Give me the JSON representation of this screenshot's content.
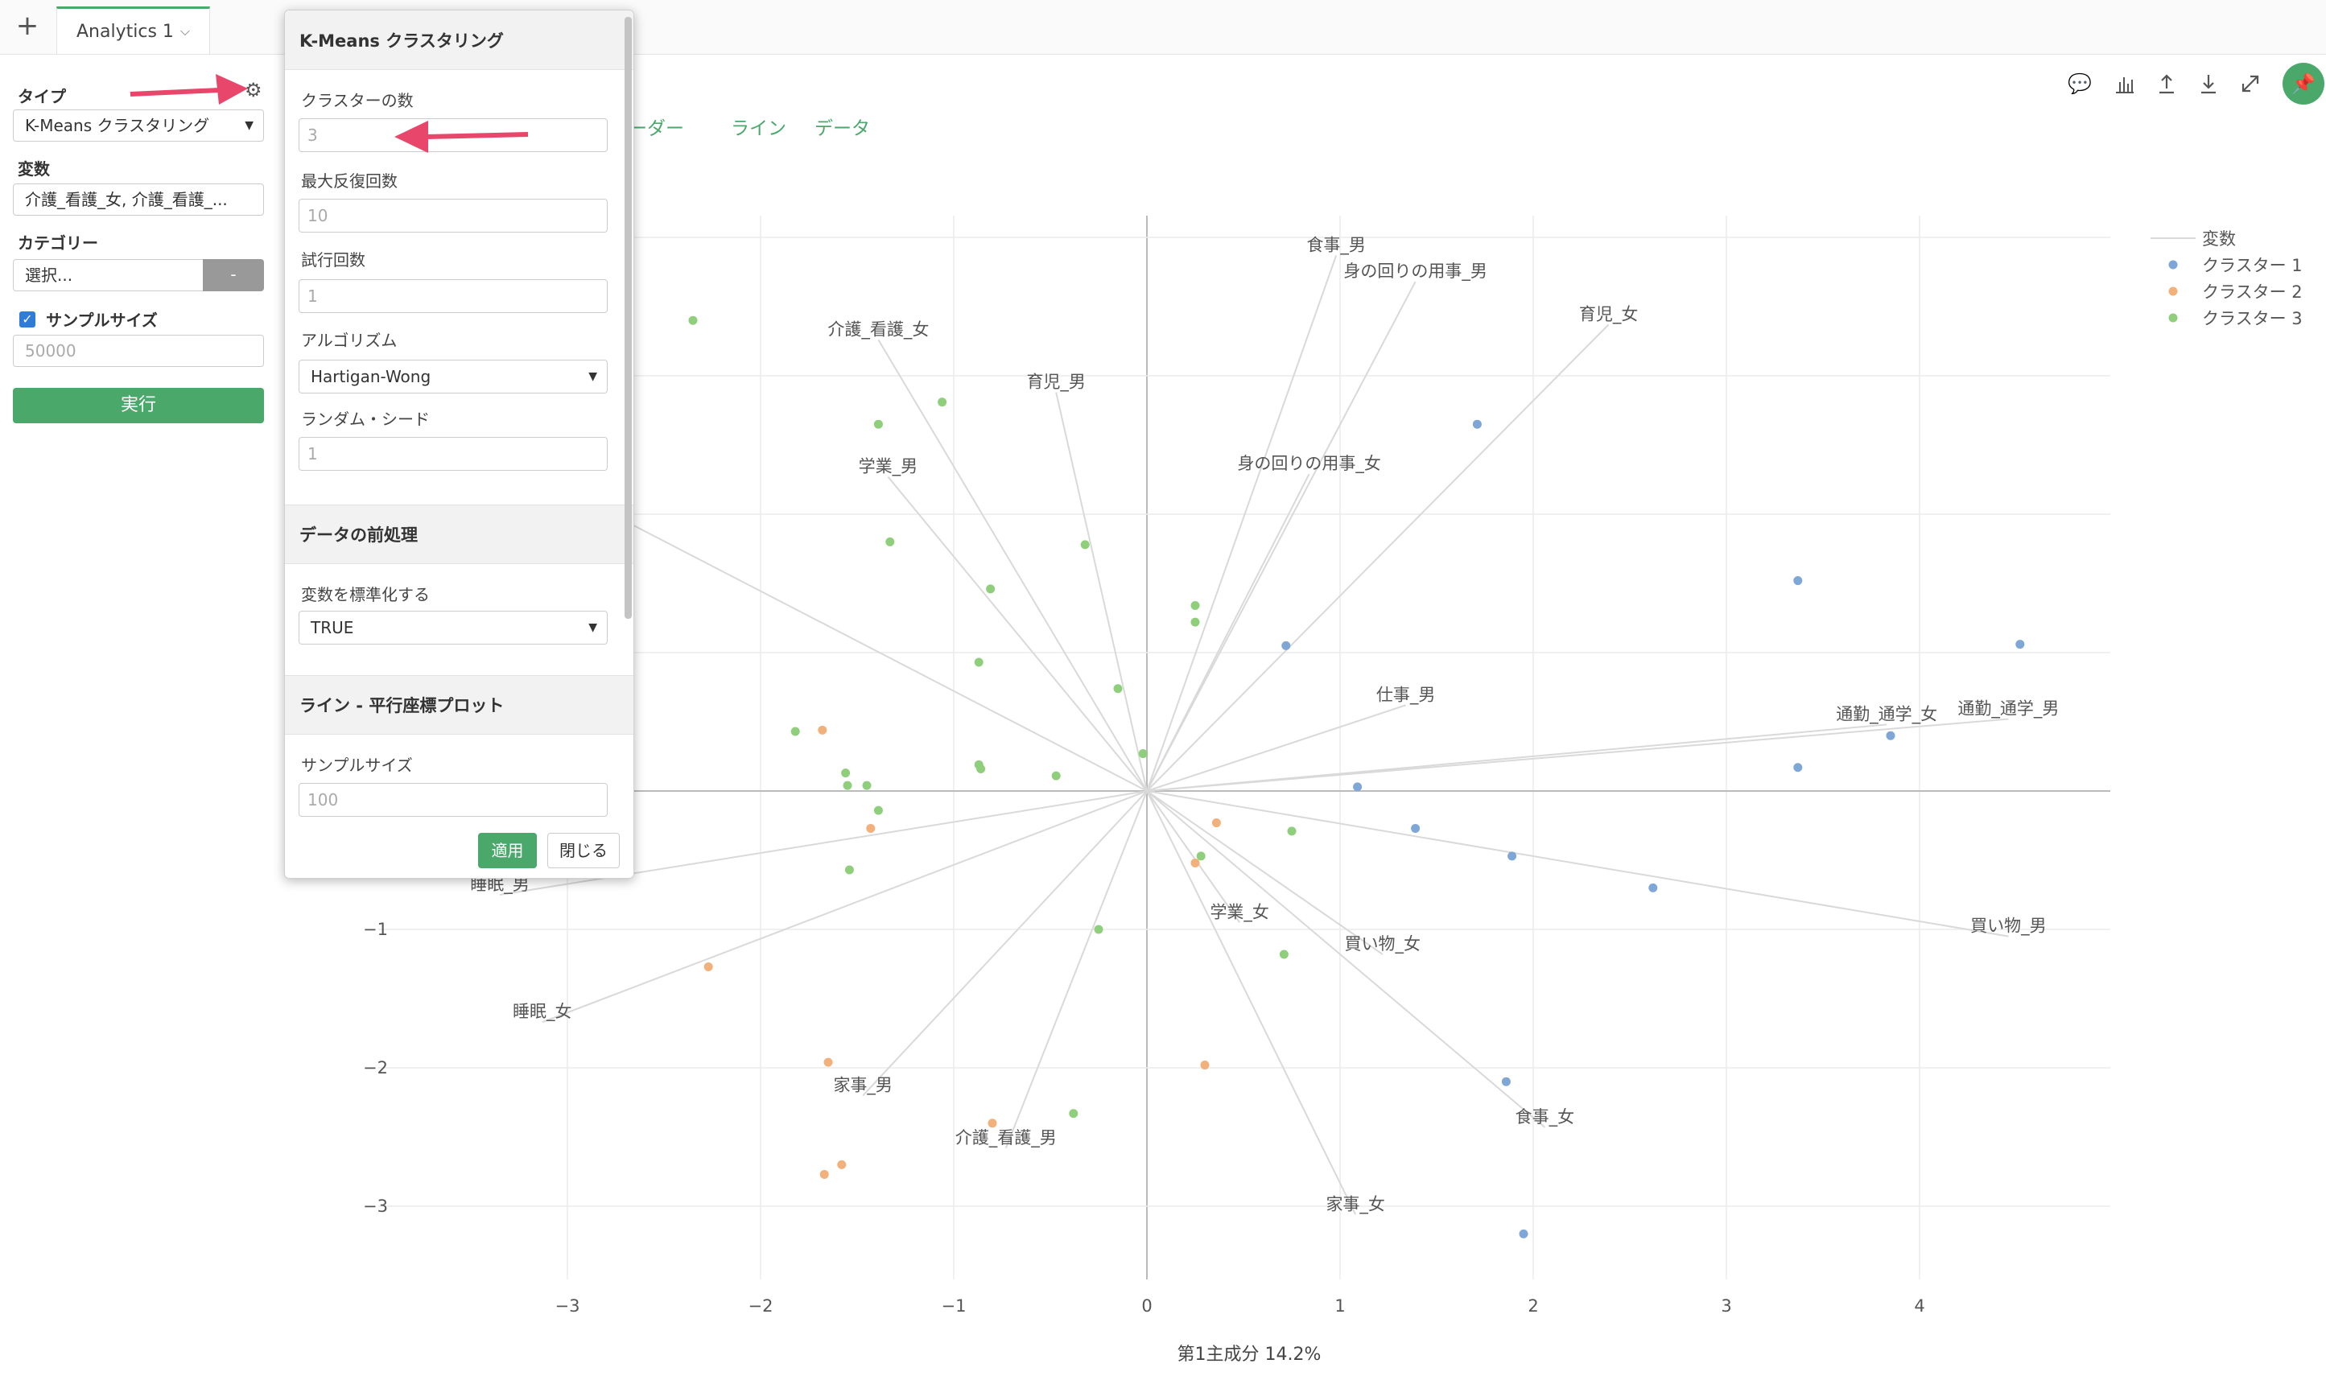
{
  "topbar": {
    "add_label": "+",
    "tab_label": "Analytics 1"
  },
  "sidebar": {
    "type_label": "タイプ",
    "type_value": "K-Means クラスタリング",
    "variables_label": "変数",
    "variables_value": "介護_看護_女, 介護_看護_...",
    "category_label": "カテゴリー",
    "category_value": "選択...",
    "category_button": "-",
    "sample_size_label": "サンプルサイズ",
    "sample_size_value": "50000",
    "run_button": "実行"
  },
  "panel": {
    "title": "K-Means クラスタリング",
    "fields": {
      "clusters_label": "クラスターの数",
      "clusters_value": "3",
      "max_iter_label": "最大反復回数",
      "max_iter_value": "10",
      "trials_label": "試行回数",
      "trials_value": "1",
      "algorithm_label": "アルゴリズム",
      "algorithm_value": "Hartigan-Wong",
      "seed_label": "ランダム・シード",
      "seed_value": "1"
    },
    "preprocess_title": "データの前処理",
    "standardize_label": "変数を標準化する",
    "standardize_value": "TRUE",
    "line_title": "ライン - 平行座標プロット",
    "line_sample_label": "サンプルサイズ",
    "line_sample_value": "100",
    "apply_button": "適用",
    "close_button": "閉じる"
  },
  "chart_tabs": [
    "レーダー",
    "ライン",
    "データ"
  ],
  "toolbar_icons": [
    "comment-icon",
    "bar-chart-icon",
    "upload-icon",
    "download-icon",
    "expand-icon",
    "pin-icon"
  ],
  "chart_data": {
    "type": "scatter",
    "xlabel": "第1主成分 14.2%",
    "ylabel": "",
    "xlim": [
      -3.2,
      4.95
    ],
    "ylim": [
      -3.4,
      4.2
    ],
    "x_ticks": [
      "−3",
      "−2",
      "−1",
      "0",
      "1",
      "2",
      "3",
      "4"
    ],
    "y_ticks": [
      "−3",
      "−2",
      "−1"
    ],
    "legend": {
      "title": "変数",
      "placement": "top-right",
      "entries": [
        "クラスター 1",
        "クラスター 2",
        "クラスター 3"
      ]
    },
    "colors": {
      "cluster1": "#7ea6d6",
      "cluster2": "#f2b07a",
      "cluster3": "#8fcf7c",
      "vector": "#d9d9d9"
    },
    "vectors": [
      {
        "label": "食事_男",
        "x": 0.98,
        "y": 3.87
      },
      {
        "label": "身の回りの用事_男",
        "x": 1.39,
        "y": 3.68
      },
      {
        "label": "育児_女",
        "x": 2.39,
        "y": 3.37
      },
      {
        "label": "介護_看護_女",
        "x": -1.39,
        "y": 3.26
      },
      {
        "label": "育児_男",
        "x": -0.47,
        "y": 2.88
      },
      {
        "label": "身の回りの用事_女",
        "x": 0.84,
        "y": 2.29
      },
      {
        "label": "学業_男",
        "x": -1.34,
        "y": 2.27
      },
      {
        "label": "仕事_男",
        "x": 1.34,
        "y": 0.62
      },
      {
        "label": "通勤_通学_女",
        "x": 3.83,
        "y": 0.48
      },
      {
        "label": "通勤_通学_男",
        "x": 4.46,
        "y": 0.52
      },
      {
        "label": "買い物_男",
        "x": 4.46,
        "y": -1.05
      },
      {
        "label": "学業_女",
        "x": 0.48,
        "y": -0.95
      },
      {
        "label": "買い物_女",
        "x": 1.22,
        "y": -1.18
      },
      {
        "label": "食事_女",
        "x": 2.06,
        "y": -2.43
      },
      {
        "label": "家事_女",
        "x": 1.08,
        "y": -3.06
      },
      {
        "label": "介護_看護_男",
        "x": -0.73,
        "y": -2.58
      },
      {
        "label": "家事_男",
        "x": -1.47,
        "y": -2.2
      },
      {
        "label": "睡眠_男",
        "x": -3.35,
        "y": -0.75
      },
      {
        "label": "睡眠_女",
        "x": -3.13,
        "y": -1.67
      },
      {
        "label": "",
        "x": -3.6,
        "y": 2.6
      }
    ],
    "series": [
      {
        "name": "クラスター 1",
        "points": [
          [
            1.71,
            2.65
          ],
          [
            0.72,
            1.05
          ],
          [
            3.37,
            1.52
          ],
          [
            4.52,
            1.06
          ],
          [
            3.85,
            0.4
          ],
          [
            3.37,
            0.17
          ],
          [
            1.09,
            0.03
          ],
          [
            1.39,
            -0.27
          ],
          [
            1.89,
            -0.47
          ],
          [
            2.62,
            -0.7
          ],
          [
            1.86,
            -2.1
          ],
          [
            1.95,
            -3.2
          ]
        ]
      },
      {
        "name": "クラスター 2",
        "points": [
          [
            -1.68,
            0.44
          ],
          [
            -1.43,
            -0.27
          ],
          [
            0.36,
            -0.23
          ],
          [
            0.25,
            -0.52
          ],
          [
            -2.27,
            -1.27
          ],
          [
            -1.65,
            -1.96
          ],
          [
            0.3,
            -1.98
          ],
          [
            -0.8,
            -2.4
          ],
          [
            -1.58,
            -2.7
          ],
          [
            -1.67,
            -2.77
          ]
        ]
      },
      {
        "name": "クラスター 3",
        "points": [
          [
            -2.35,
            3.4
          ],
          [
            -1.06,
            2.81
          ],
          [
            -1.39,
            2.65
          ],
          [
            -0.32,
            1.78
          ],
          [
            -1.33,
            1.8
          ],
          [
            -0.81,
            1.46
          ],
          [
            0.25,
            1.34
          ],
          [
            0.25,
            1.22
          ],
          [
            -0.87,
            0.93
          ],
          [
            -0.15,
            0.74
          ],
          [
            -1.82,
            0.43
          ],
          [
            -1.56,
            0.13
          ],
          [
            -1.55,
            0.04
          ],
          [
            -1.45,
            0.04
          ],
          [
            -0.87,
            0.19
          ],
          [
            -0.86,
            0.16
          ],
          [
            -0.47,
            0.11
          ],
          [
            -0.02,
            0.27
          ],
          [
            -1.39,
            -0.14
          ],
          [
            0.75,
            -0.29
          ],
          [
            0.28,
            -0.47
          ],
          [
            -1.54,
            -0.57
          ],
          [
            -0.25,
            -1.0
          ],
          [
            0.71,
            -1.18
          ],
          [
            -0.38,
            -2.33
          ]
        ]
      }
    ]
  }
}
